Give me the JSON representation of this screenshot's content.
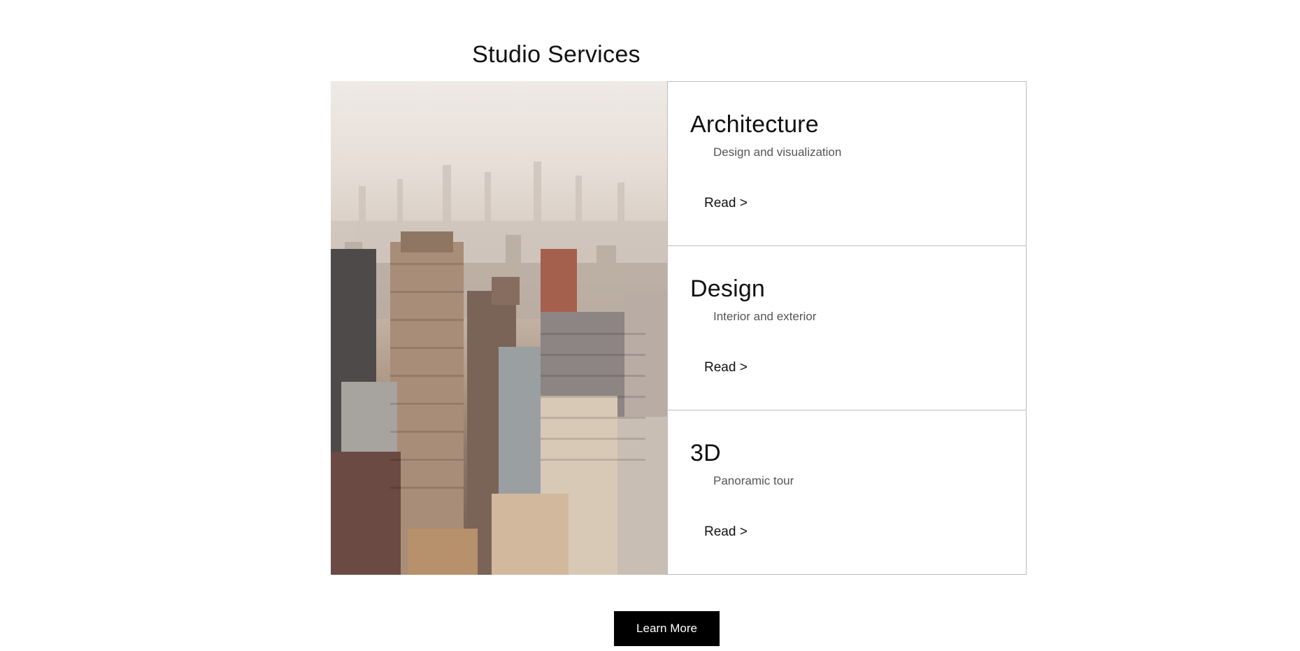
{
  "page": {
    "title": "Studio Services"
  },
  "image": {
    "name": "city-skyline-photo",
    "subject": "aerial view of city skyscrapers in haze"
  },
  "cards": [
    {
      "title": "Architecture",
      "subtitle": "Design and visualization",
      "link": "Read >"
    },
    {
      "title": "Design",
      "subtitle": "Interior and exterior",
      "link": "Read >"
    },
    {
      "title": "3D",
      "subtitle": "Panoramic tour",
      "link": "Read >"
    }
  ],
  "cta": {
    "label": "Learn More",
    "background": "#000000",
    "color": "#ffffff"
  }
}
